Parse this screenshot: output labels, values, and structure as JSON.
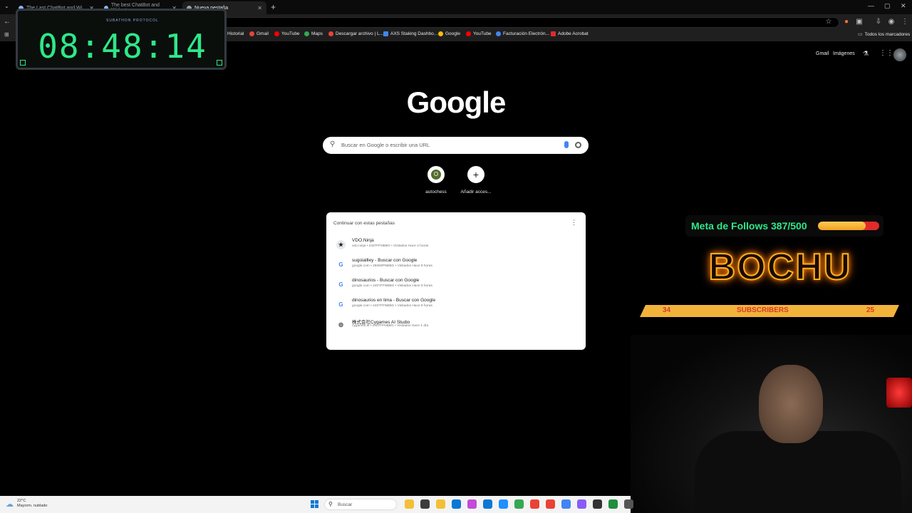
{
  "browser": {
    "tabs": [
      {
        "label": "The Last ChatBot and Wi...",
        "active": false
      },
      {
        "label": "The best ChatBot and Widget...",
        "active": false
      },
      {
        "label": "Nueva pestaña",
        "active": true
      }
    ],
    "new_tab": "+",
    "window_controls": [
      "—",
      "▢",
      "✕"
    ],
    "bookmarks": [
      {
        "label": "Historial",
        "color": "#9aa0a6"
      },
      {
        "label": "Gmail",
        "color": "#ea4335"
      },
      {
        "label": "YouTube",
        "color": "#ff0000"
      },
      {
        "label": "Maps",
        "color": "#34a853"
      },
      {
        "label": "Descargar archivo | L...",
        "color": "#ea4335"
      },
      {
        "label": "AXS Staking Dashbo...",
        "color": "#4285f4"
      },
      {
        "label": "Google",
        "color": "#fbbc05"
      },
      {
        "label": "YouTube",
        "color": "#ff0000"
      },
      {
        "label": "Facturación Electrón...",
        "color": "#4285f4"
      },
      {
        "label": "Adobe Acrobat",
        "color": "#e02b2b"
      }
    ],
    "all_bookmarks": "Todos los marcadores"
  },
  "timer": {
    "label": "SUBATHON PROTOCOL",
    "value": "08:48:14"
  },
  "google": {
    "top_links": {
      "gmail": "Gmail",
      "images": "Imágenes"
    },
    "logo": "Google",
    "search_placeholder": "Buscar en Google o escribir una URL",
    "shortcuts": [
      {
        "label": "autochess",
        "icon": "O"
      },
      {
        "label": "Añadir acces...",
        "icon": "+"
      }
    ],
    "continue_card": {
      "heading": "Continuar con estas pestañas",
      "items": [
        {
          "title": "VDO.Ninja",
          "meta": "vdo.ninja • 2407FFNBBG • Visitados Hace 2 horas",
          "icon": "ninja-icon",
          "favicon": "★"
        },
        {
          "title": "sugoiallley - Buscar con Google",
          "meta": "google.com • 25069PNBBG • Visitados Hace 8 horas",
          "icon": "google-icon",
          "favicon": "G"
        },
        {
          "title": "dinosaurios - Buscar con Google",
          "meta": "google.com • 2407FFNBBG • Visitados Hace 9 horas",
          "icon": "google-icon",
          "favicon": "G"
        },
        {
          "title": "dinosaurios en lima - Buscar con Google",
          "meta": "google.com • 2407FFNBBG • Visitados Hace 9 horas",
          "icon": "google-icon",
          "favicon": "G"
        },
        {
          "title": "株式会社Cygames AI Studio",
          "meta": "cygames.ai • 2407FFNBBG • Visitados Hace 1 día",
          "icon": "globe-icon",
          "favicon": "◍"
        }
      ]
    }
  },
  "overlay": {
    "follows_text": "Meta de Follows 387/500",
    "follows_progress": 0.774,
    "brand": "BOCHU",
    "subs_left": "34",
    "subs_label": "SUBSCRIBERS",
    "subs_right": "25"
  },
  "taskbar": {
    "weather_temp": "22°C",
    "weather_desc": "Mayorm. nublado",
    "search_label": "Buscar",
    "apps": [
      "#f2c037",
      "#3c3c3c",
      "#f2c037",
      "#0a78d4",
      "#c24bd8",
      "#0a78d4",
      "#1e90ff",
      "#34a853",
      "#ea4335",
      "#ea4335",
      "#4285f4",
      "#8a5cf6",
      "#333",
      "#1e8e3e",
      "#555"
    ]
  }
}
